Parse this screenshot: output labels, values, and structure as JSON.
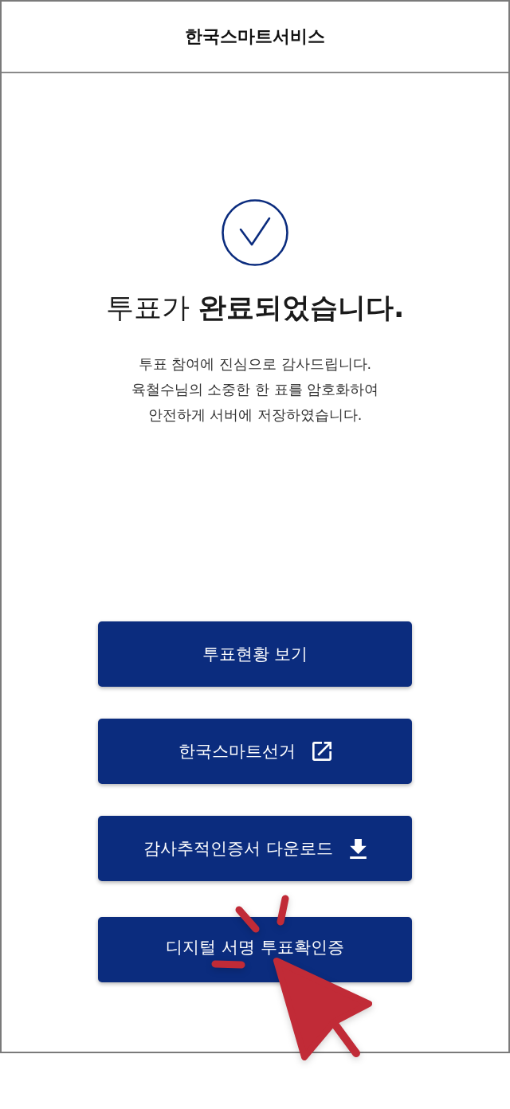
{
  "header": {
    "title": "한국스마트서비스"
  },
  "headline": "투표가 **완료되었습니다.**",
  "message": "투표 참여에 진심으로 감사드립니다.\n육철수님의 소중한 한 표를 암호화하여\n안전하게 서버에 저장하였습니다.",
  "buttons": [
    {
      "label": "투표현황 보기",
      "kind": "plain"
    },
    {
      "label": "한국스마트선거",
      "kind": "external"
    },
    {
      "label": "감사추적인증서 다운로드",
      "kind": "download"
    },
    {
      "label": "디지털 서명 투표확인증",
      "kind": "plain"
    }
  ]
}
